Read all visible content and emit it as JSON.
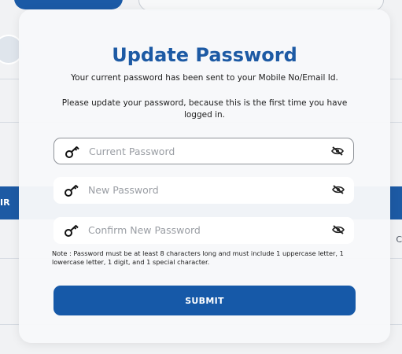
{
  "background": {
    "left_cut_text": "IR",
    "right_cut_text": "C"
  },
  "dialog": {
    "title": "Update Password",
    "subtitle": "Your current password has been sent to your Mobile No/Email Id.",
    "message": "Please update your password, because this is the first time you have logged in.",
    "fields": [
      {
        "name": "current",
        "placeholder": "Current Password",
        "value": "",
        "icon": "key-icon",
        "toggle_icon": "eye-slash-icon"
      },
      {
        "name": "new",
        "placeholder": "New Password",
        "value": "",
        "icon": "key-icon",
        "toggle_icon": "eye-slash-icon"
      },
      {
        "name": "confirm",
        "placeholder": "Confirm New Password",
        "value": "",
        "icon": "key-icon",
        "toggle_icon": "eye-slash-icon"
      }
    ],
    "note": "Note : Password must be at least 8 characters long and must include 1 uppercase letter, 1 lowercase letter, 1 digit, and 1 special character.",
    "submit_label": "SUBMIT"
  },
  "colors": {
    "primary": "#1D5AA4",
    "button": "#1659A8",
    "field_bg": "#FFFFFF",
    "modal_bg": "#F7F8FA"
  }
}
